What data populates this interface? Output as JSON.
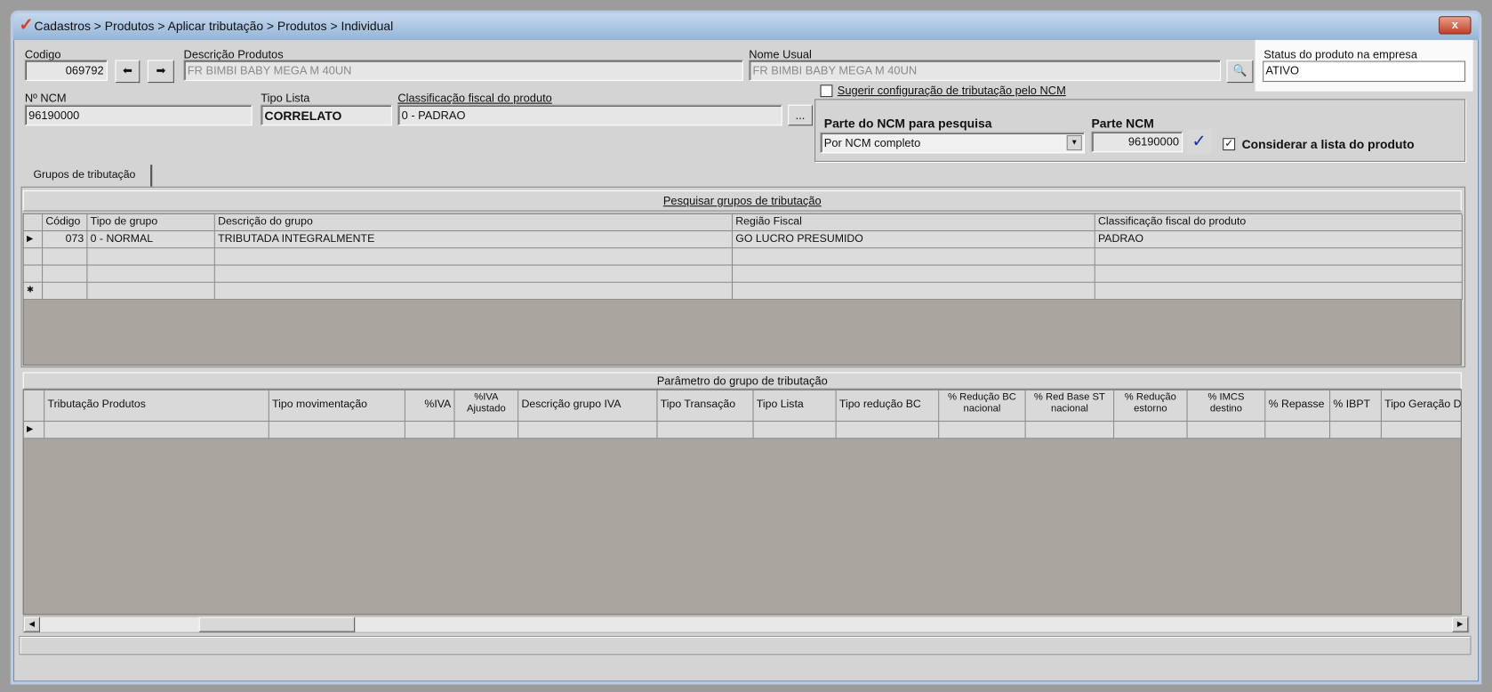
{
  "window": {
    "title": "Cadastros > Produtos > Aplicar tributação > Produtos > Individual",
    "close_label": "x"
  },
  "form": {
    "codigo_label": "Codigo",
    "codigo_value": "069792",
    "descricao_label": "Descrição  Produtos",
    "descricao_value": "FR BIMBI BABY MEGA M 40UN",
    "nome_usual_label": "Nome Usual",
    "nome_usual_value": "FR BIMBI BABY MEGA M 40UN",
    "status_label": "Status do produto na empresa",
    "status_value": "ATIVO",
    "ncm_label": "Nº NCM",
    "ncm_value": "96190000",
    "tipo_lista_label": "Tipo Lista",
    "tipo_lista_value": "CORRELATO",
    "classificacao_label": "Classificação fiscal do produto",
    "classificacao_value": "0 - PADRAO",
    "ellipsis_label": "...",
    "sugerir_label": "Sugerir configuração de tributação pelo NCM",
    "sugerir_checked": false,
    "parte_ncm_pesquisa_label": "Parte do NCM para pesquisa",
    "parte_ncm_pesquisa_value": "Por NCM completo",
    "parte_ncm_label": "Parte NCM",
    "parte_ncm_value": "96190000",
    "considerar_label": "Considerar a lista do produto",
    "considerar_checked": true
  },
  "tabs": [
    {
      "label": "Grupos de tributação"
    }
  ],
  "grupos": {
    "caption": "Pesquisar grupos de tributação",
    "columns": [
      "Código",
      "Tipo de grupo",
      "Descrição do grupo",
      "Região Fiscal",
      "Classificação fiscal do produto"
    ],
    "rows": [
      [
        "073",
        "0 - NORMAL",
        "TRIBUTADA INTEGRALMENTE",
        "GO LUCRO PRESUMIDO",
        "PADRAO"
      ]
    ]
  },
  "parametros": {
    "caption": "Parâmetro do grupo de tributação",
    "columns": [
      "Tributação Produtos",
      "Tipo movimentação",
      "%IVA",
      "%IVA Ajustado",
      "Descrição grupo IVA",
      "Tipo Transação",
      "Tipo Lista",
      "Tipo redução BC",
      "% Redução BC nacional",
      "% Red Base ST nacional",
      "% Redução estorno",
      "% IMCS destino",
      "% Repasse",
      "% IBPT",
      "Tipo Geração D"
    ]
  }
}
